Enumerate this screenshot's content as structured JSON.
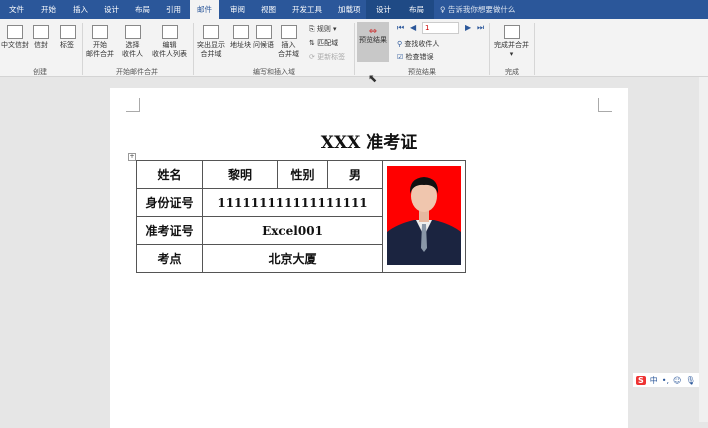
{
  "tabs": [
    "文件",
    "开始",
    "插入",
    "设计",
    "布局",
    "引用",
    "邮件",
    "审阅",
    "视图",
    "开发工具",
    "加载项",
    "设计",
    "布局"
  ],
  "search": "告诉我你想要做什么",
  "ribbon": {
    "create": {
      "label": "创建",
      "items": [
        "中文信封",
        "信封",
        "标签"
      ]
    },
    "start": {
      "label": "开始邮件合并",
      "items": [
        "开始\n邮件合并",
        "选择\n收件人",
        "编辑\n收件人列表"
      ]
    },
    "write": {
      "label": "编写和插入域",
      "items": [
        "突出显示\n合并域",
        "地址块",
        "问候语",
        "插入\n合并域"
      ],
      "small": [
        "规则",
        "匹配域",
        "更新标签"
      ]
    },
    "preview": {
      "label": "预览结果",
      "button": "预览结果",
      "record": "1",
      "small": [
        "查找收件人",
        "检查错误"
      ]
    },
    "finish": {
      "label": "完成",
      "button": "完成并合并"
    }
  },
  "doc": {
    "title": "XXX 准考证",
    "rows": [
      {
        "label": "姓名",
        "value": "黎明",
        "label2": "性别",
        "value2": "男"
      },
      {
        "label": "身份证号",
        "value": "111111111111111111"
      },
      {
        "label": "准考证号",
        "value": "Excel001"
      },
      {
        "label": "考点",
        "value": "北京大厦"
      }
    ]
  },
  "ime": {
    "label": "中"
  }
}
